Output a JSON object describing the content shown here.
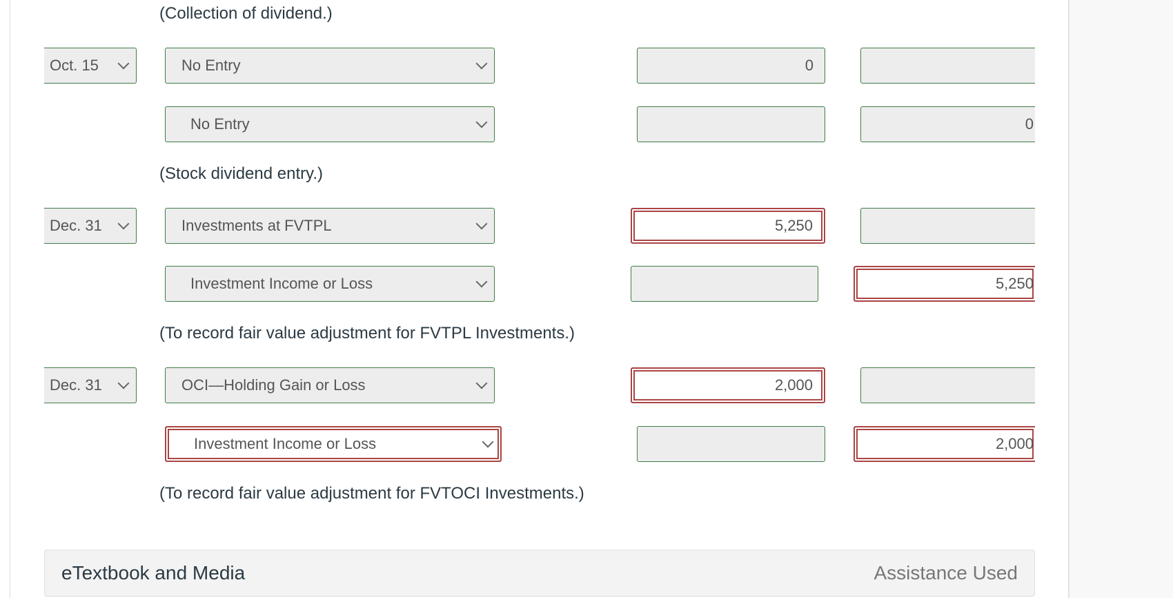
{
  "entries": [
    {
      "description_above": "(Collection of dividend.)",
      "date": "Oct. 15",
      "lines": [
        {
          "account": "No Entry",
          "debit": "0",
          "credit": "",
          "account_error": false,
          "debit_error": false,
          "credit_error": false
        },
        {
          "account": "No Entry",
          "debit": "",
          "credit": "0",
          "account_error": false,
          "debit_error": false,
          "credit_error": false
        }
      ]
    },
    {
      "description_above": "(Stock dividend entry.)",
      "date": "Dec. 31",
      "lines": [
        {
          "account": "Investments at FVTPL",
          "debit": "5,250",
          "credit": "",
          "account_error": false,
          "debit_error": true,
          "credit_error": false
        },
        {
          "account": "Investment Income or Loss",
          "debit": "",
          "credit": "5,250",
          "account_error": false,
          "debit_error": false,
          "credit_error": true
        }
      ]
    },
    {
      "description_above": "(To record fair value adjustment for FVTPL Investments.)",
      "date": "Dec. 31",
      "lines": [
        {
          "account": "OCI—Holding Gain or Loss",
          "debit": "2,000",
          "credit": "",
          "account_error": false,
          "debit_error": true,
          "credit_error": false
        },
        {
          "account": "Investment Income or Loss",
          "debit": "",
          "credit": "2,000",
          "account_error": true,
          "debit_error": false,
          "credit_error": true
        }
      ]
    }
  ],
  "final_description": "(To record fair value adjustment for FVTOCI Investments.)",
  "footer": {
    "left_label": "eTextbook and Media",
    "right_label": "Assistance Used"
  },
  "colors": {
    "valid_border": "#3f7b45",
    "error_border": "#a94442",
    "field_bg": "#ededed"
  }
}
